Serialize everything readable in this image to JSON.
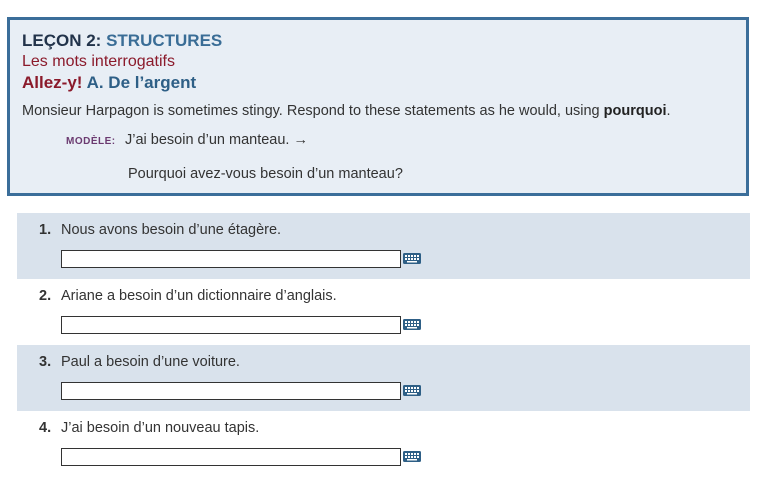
{
  "header": {
    "lecon_label": "LEÇON 2:",
    "lecon_topic": "STRUCTURES",
    "subtitle": "Les mots interrogatifs",
    "allez": "Allez-y!",
    "activity_title": "A. De l’argent",
    "instructions_pre": "Monsieur Harpagon is sometimes stingy. Respond to these statements as he would, using ",
    "instructions_bold": "pourquoi",
    "instructions_post": ".",
    "modele_label": "MODÈLE:",
    "modele_prompt": "J’ai besoin d’un manteau. →",
    "modele_answer": "Pourquoi avez-vous besoin d’un manteau?"
  },
  "items": [
    {
      "number": "1.",
      "text": "Nous avons besoin d’une étagère.",
      "value": "",
      "icon": "keyboard-icon"
    },
    {
      "number": "2.",
      "text": "Ariane a besoin d’un dictionnaire d’anglais.",
      "value": "",
      "icon": "keyboard-icon"
    },
    {
      "number": "3.",
      "text": "Paul a besoin d’une voiture.",
      "value": "",
      "icon": "keyboard-icon"
    },
    {
      "number": "4.",
      "text": "J’ai besoin d’un nouveau tapis.",
      "value": "",
      "icon": "keyboard-icon"
    }
  ],
  "colors": {
    "header_border": "#3b6e9a",
    "header_bg": "#e8eef5",
    "accent_red": "#8b1a2b",
    "accent_blue": "#3a6d96",
    "row_shade": "#d9e2ec"
  }
}
